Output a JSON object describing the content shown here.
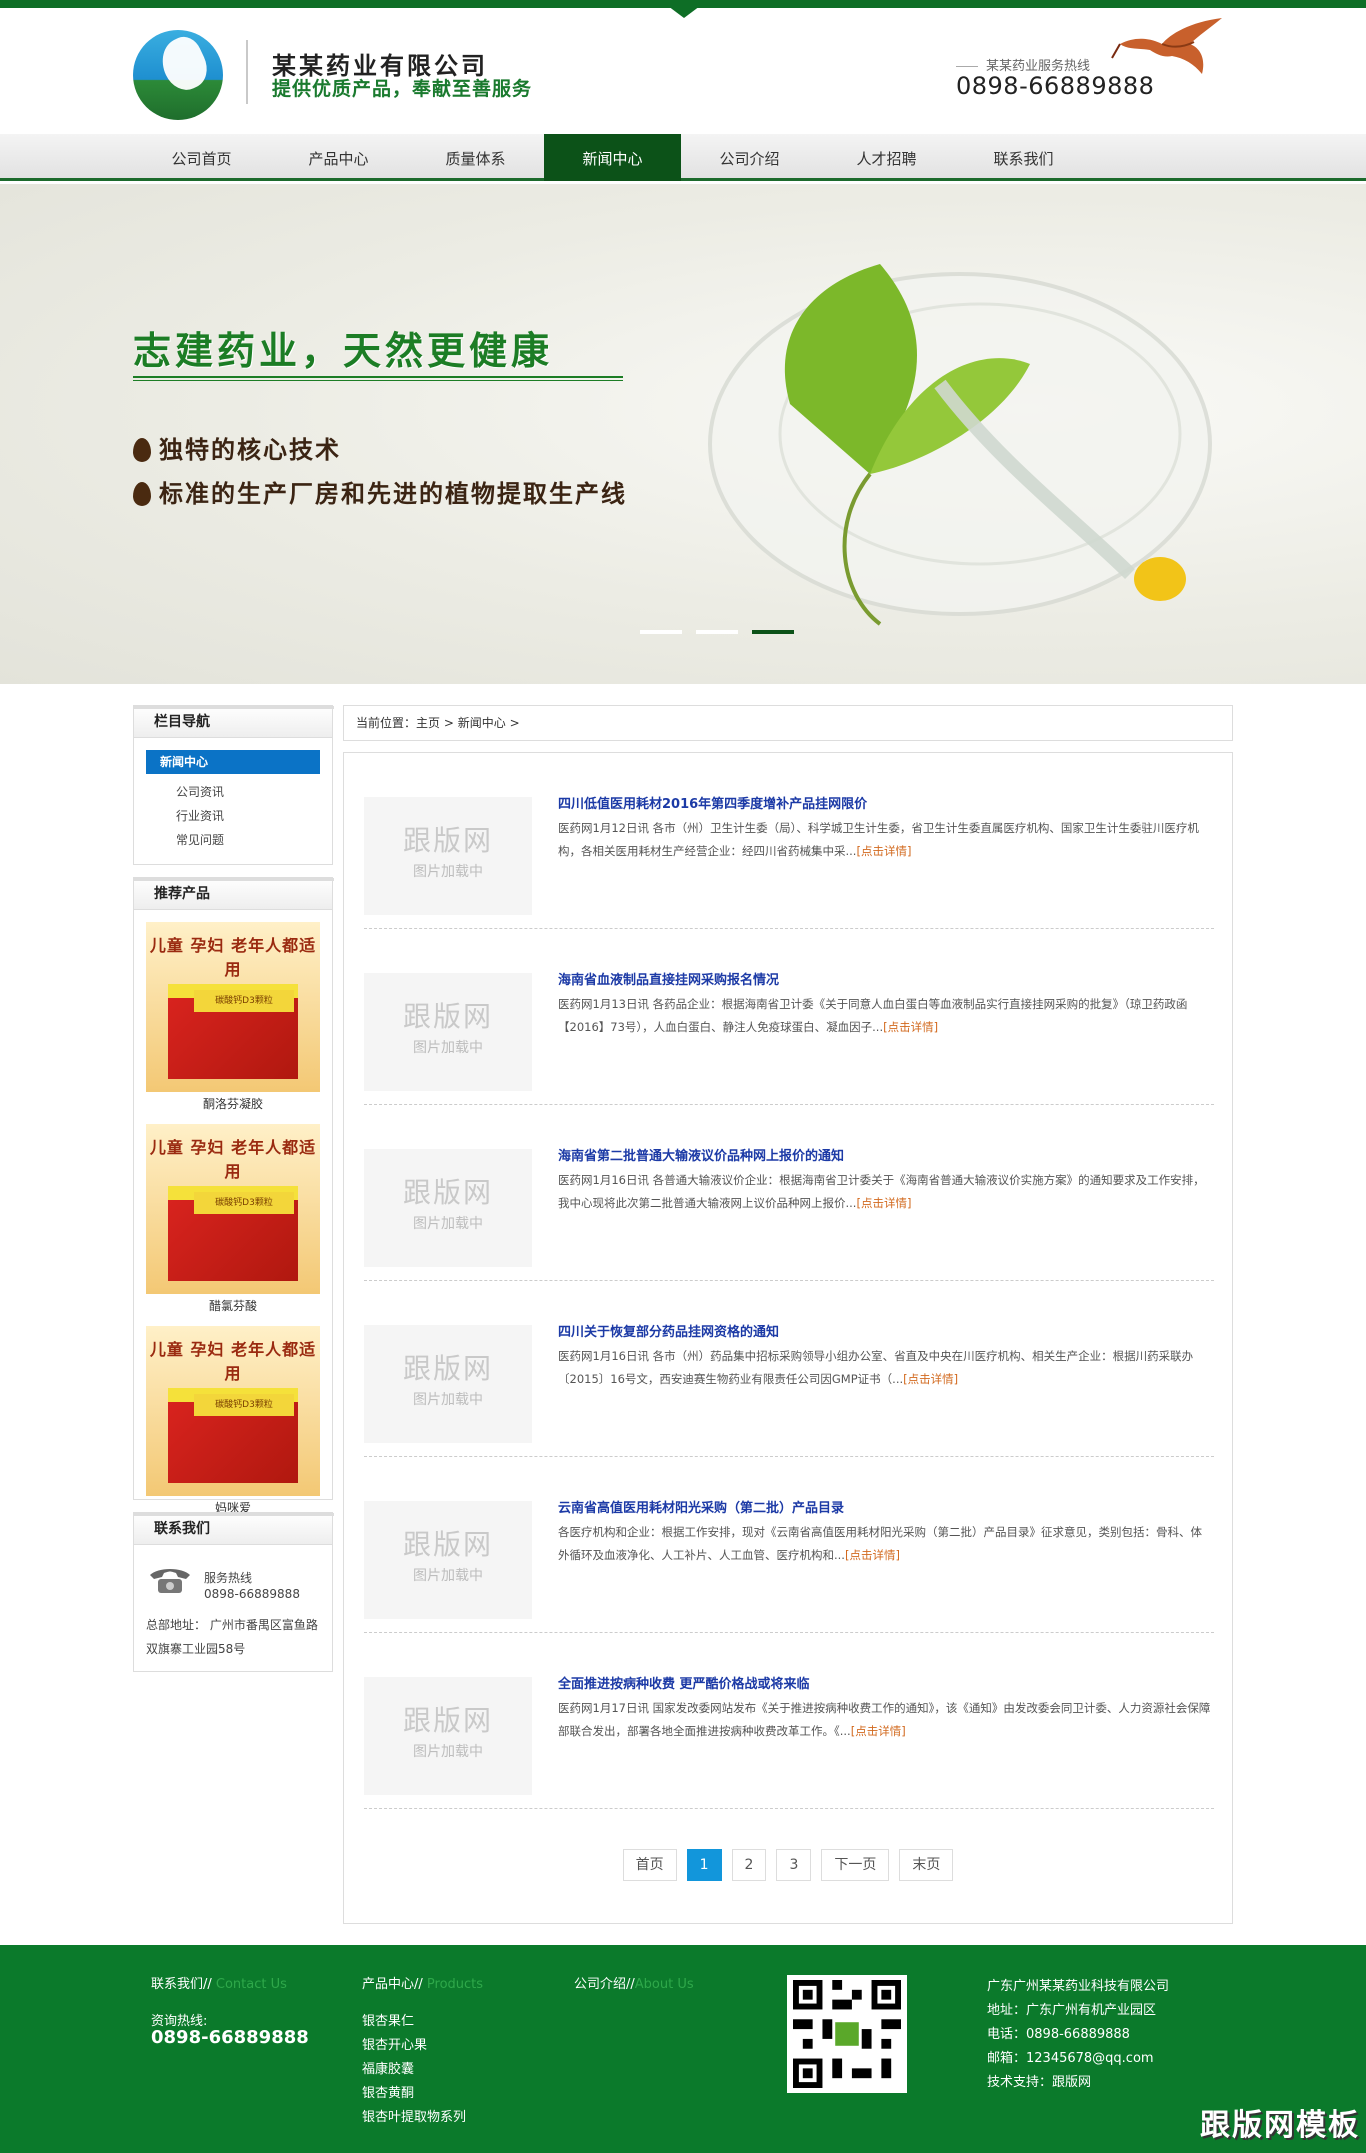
{
  "header": {
    "company_name": "某某药业有限公司",
    "slogan": "提供优质产品，奉献至善服务",
    "hotline_label": "某某药业服务热线",
    "hotline_number": "0898-66889888"
  },
  "nav": {
    "items": [
      {
        "label": "公司首页",
        "active": false
      },
      {
        "label": "产品中心",
        "active": false
      },
      {
        "label": "质量体系",
        "active": false
      },
      {
        "label": "新闻中心",
        "active": true
      },
      {
        "label": "公司介绍",
        "active": false
      },
      {
        "label": "人才招聘",
        "active": false
      },
      {
        "label": "联系我们",
        "active": false
      }
    ]
  },
  "banner": {
    "title": "志建药业，天然更健康",
    "bullets": [
      "独特的核心技术",
      "标准的生产厂房和先进的植物提取生产线"
    ],
    "slides_count": 3,
    "active_slide": 3
  },
  "sidebar": {
    "nav_title": "栏目导航",
    "active_category": "新闻中心",
    "categories": [
      "公司资讯",
      "行业资讯",
      "常见问题"
    ],
    "products_title": "推荐产品",
    "products": [
      {
        "name": "酮洛芬凝胶",
        "box_top": "儿童 孕妇 老年人都适用",
        "box_label": "碳酸钙D3颗粒"
      },
      {
        "name": "醋氯芬酸",
        "box_top": "儿童 孕妇 老年人都适用",
        "box_label": "碳酸钙D3颗粒"
      },
      {
        "name": "妈咪爱",
        "box_top": "儿童 孕妇 老年人都适用",
        "box_label": "碳酸钙D3颗粒"
      }
    ],
    "contact_title": "联系我们",
    "contact_hotline_label": "服务热线",
    "contact_hotline": "0898-66889888",
    "contact_address": "总部地址： 广州市番禺区富鱼路双旗寨工业园58号"
  },
  "breadcrumb": {
    "prefix": "当前位置：",
    "home": "主页",
    "sep1": ">",
    "current": "新闻中心",
    "sep2": ">"
  },
  "news": {
    "thumb_brand": "跟版网",
    "thumb_loading": "图片加载中",
    "more_link": "[点击详情]",
    "items": [
      {
        "title": "四川低值医用耗材2016年第四季度增补产品挂网限价",
        "desc": "医药网1月12日讯 各市（州）卫生计生委（局）、科学城卫生计生委，省卫生计生委直属医疗机构、国家卫生计生委驻川医疗机构，各相关医用耗材生产经营企业：经四川省药械集中采..."
      },
      {
        "title": "海南省血液制品直接挂网采购报名情况",
        "desc": "医药网1月13日讯 各药品企业：根据海南省卫计委《关于同意人血白蛋白等血液制品实行直接挂网采购的批复》（琼卫药政函【2016】73号），人血白蛋白、静注人免疫球蛋白、凝血因子..."
      },
      {
        "title": "海南省第二批普通大输液议价品种网上报价的通知",
        "desc": "医药网1月16日讯 各普通大输液议价企业：根据海南省卫计委关于《海南省普通大输液议价实施方案》的通知要求及工作安排，我中心现将此次第二批普通大输液网上议价品种网上报价..."
      },
      {
        "title": "四川关于恢复部分药品挂网资格的通知",
        "desc": "医药网1月16日讯 各市（州）药品集中招标采购领导小组办公室、省直及中央在川医疗机构、相关生产企业：根据川药采联办〔2015〕16号文，西安迪赛生物药业有限责任公司因GMP证书（..."
      },
      {
        "title": "云南省高值医用耗材阳光采购（第二批）产品目录",
        "desc": "各医疗机构和企业：根据工作安排，现对《云南省高值医用耗材阳光采购（第二批）产品目录》征求意见，类别包括：骨科、体外循环及血液净化、人工补片、人工血管、医疗机构和..."
      },
      {
        "title": "全面推进按病种收费 更严酷价格战或将来临",
        "desc": "医药网1月17日讯 国家发改委网站发布《关于推进按病种收费工作的通知》，该《通知》由发改委会同卫计委、人力资源社会保障部联合发出，部署各地全面推进按病种收费改革工作。《..."
      }
    ]
  },
  "pagination": {
    "first": "首页",
    "pages": [
      "1",
      "2",
      "3"
    ],
    "current": "1",
    "next": "下一页",
    "last": "末页"
  },
  "footer": {
    "contact_title": "联系我们//",
    "contact_title_en": "Contact Us",
    "consult_label": "资询热线:",
    "consult_number": "0898-66889888",
    "products_title": "产品中心//",
    "products_title_en": "Products",
    "product_links": [
      "银杏果仁",
      "银杏开心果",
      "福康胶囊",
      "银杏黄酮",
      "银杏叶提取物系列"
    ],
    "about_title": "公司介绍//",
    "about_title_en": "About Us",
    "company": "广东广州某某药业科技有限公司",
    "address": "地址：广东广州有机产业园区",
    "phone": "电话：0898-66889888",
    "email": "邮箱：12345678@qq.com",
    "support": "技术支持：跟版网"
  },
  "watermark": "跟版网模板",
  "colors": {
    "brand_green": "#0e6e26",
    "nav_active": "#0c5218",
    "link_blue": "#1c3aa6",
    "more_orange": "#d2691e",
    "pager_active": "#1296db",
    "category_active": "#0b73c6"
  }
}
